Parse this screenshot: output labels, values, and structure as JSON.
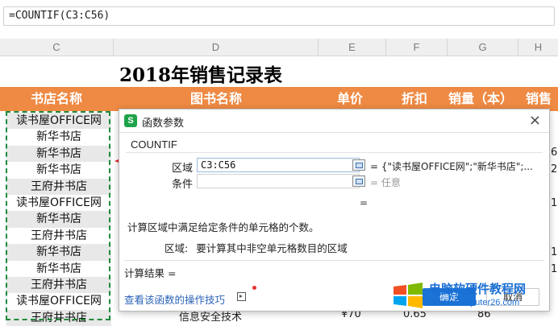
{
  "formula_bar": {
    "value": "=COUNTIF(C3:C56)"
  },
  "columns": [
    "C",
    "D",
    "E",
    "F",
    "G",
    "H"
  ],
  "sheet": {
    "title": "2018年销售记录表",
    "headers": [
      "书店名称",
      "图书名称",
      "单价",
      "折扣",
      "销量（本）",
      "销售"
    ],
    "bookstore_column": [
      "读书屋OFFICE网",
      "新华书店",
      "新华书店",
      "新华书店",
      "王府井书店",
      "读书屋OFFICE网",
      "新华书店",
      "王府井书店",
      "新华书店",
      "新华书店",
      "王府井书店",
      "读书屋OFFICE网",
      "王府井书店"
    ],
    "last_row": {
      "book": "信息安全技术",
      "price": "¥70",
      "discount": "0.65",
      "sales": "86"
    },
    "right_edge_fragments": [
      "6,",
      "2,",
      "1,",
      "1,",
      "1,"
    ]
  },
  "dialog": {
    "title": "函数参数",
    "close_label": "×",
    "function_name": "COUNTIF",
    "args": [
      {
        "label": "区域",
        "value": "C3:C56",
        "result": "= {\"读书屋OFFICE网\";\"新华书店\";..."
      },
      {
        "label": "条件",
        "value": "",
        "result": "= 任意"
      }
    ],
    "equals_line": "=",
    "description": "计算区域中满足给定条件的单元格的个数。",
    "param_label": "区域:",
    "param_text": "要计算其中非空单元格数目的区域",
    "result_label": "计算结果 =",
    "help_link": "查看该函数的操作技巧",
    "ok_label": "确定",
    "cancel_label": "取消"
  },
  "watermark": {
    "name": "电脑软硬件教程网",
    "url": "www.computer26.com"
  },
  "colors": {
    "header_orange": "#ee8a43",
    "selection_green": "#1f8a3a",
    "accent_blue": "#1b73d6",
    "arrow_red": "#e53333"
  }
}
